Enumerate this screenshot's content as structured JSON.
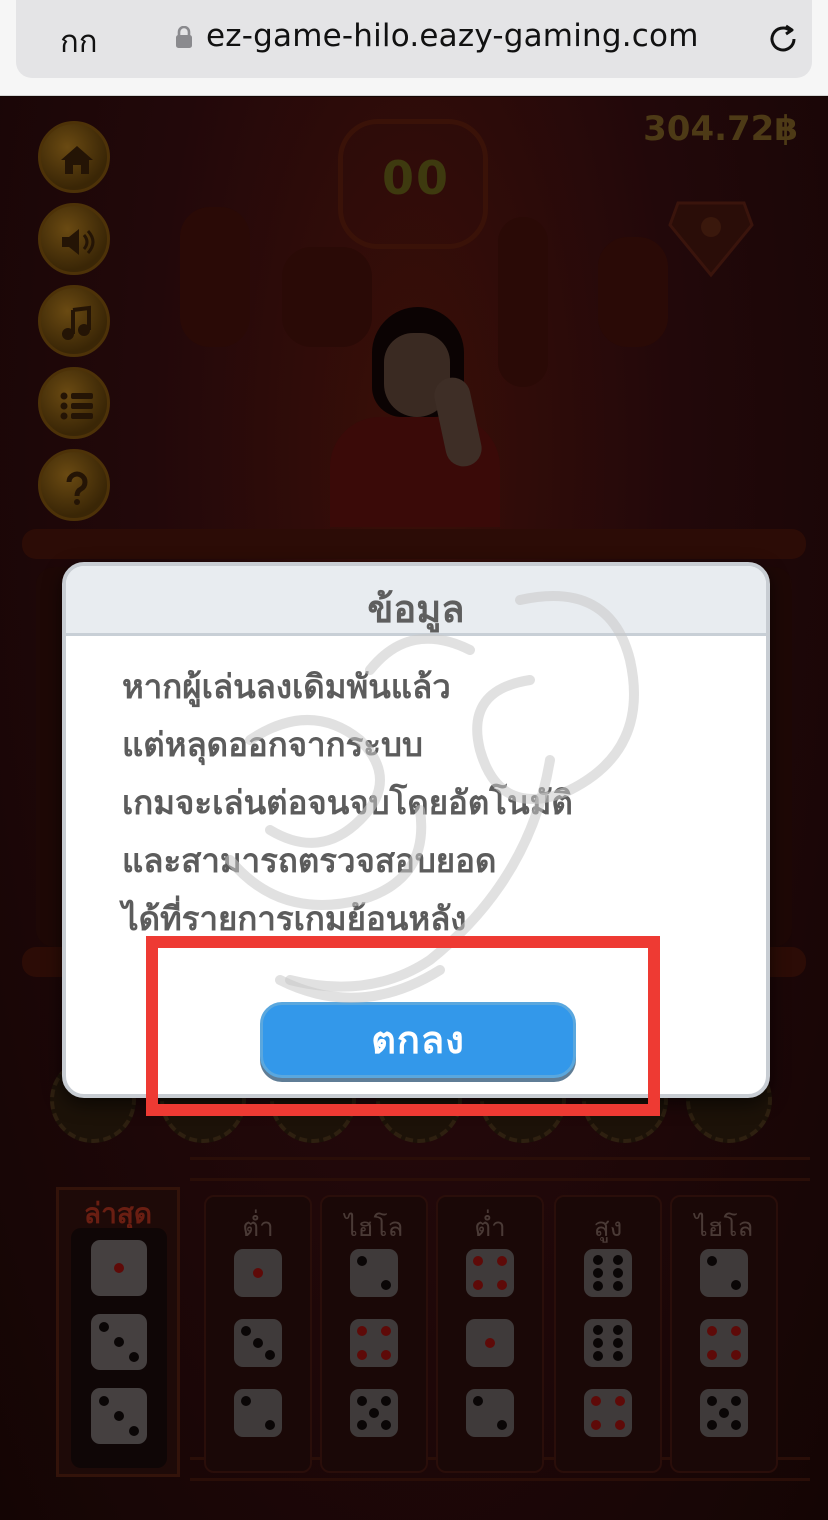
{
  "browser": {
    "aa_label": "กก",
    "url": "ez-game-hilo.eazy-gaming.com"
  },
  "game": {
    "balance": "304.72฿",
    "timer": "00",
    "history": {
      "latest_label": "ล่าสุด",
      "columns": [
        "ต่ำ",
        "ไฮโล",
        "ต่ำ",
        "สูง",
        "ไฮโล"
      ]
    }
  },
  "dialog": {
    "title": "ข้อมูล",
    "lines": [
      "หากผู้เล่นลงเดิมพันแล้ว",
      "แต่หลุดออกจากระบบ",
      "เกมจะเล่นต่อจนจบโดยอัตโนมัติ",
      "และสามารถตรวจสอบยอด",
      "ได้ที่รายการเกมย้อนหลัง"
    ],
    "ok_label": "ตกลง"
  },
  "colors": {
    "ok_button": "#3398ea",
    "highlight": "#ee3a33",
    "dialog_header": "#e8ecf0"
  },
  "icons": [
    "lock-icon",
    "reload-icon",
    "home-icon",
    "sound-icon",
    "music-icon",
    "menu-list-icon",
    "help-icon",
    "diamond-icon"
  ]
}
